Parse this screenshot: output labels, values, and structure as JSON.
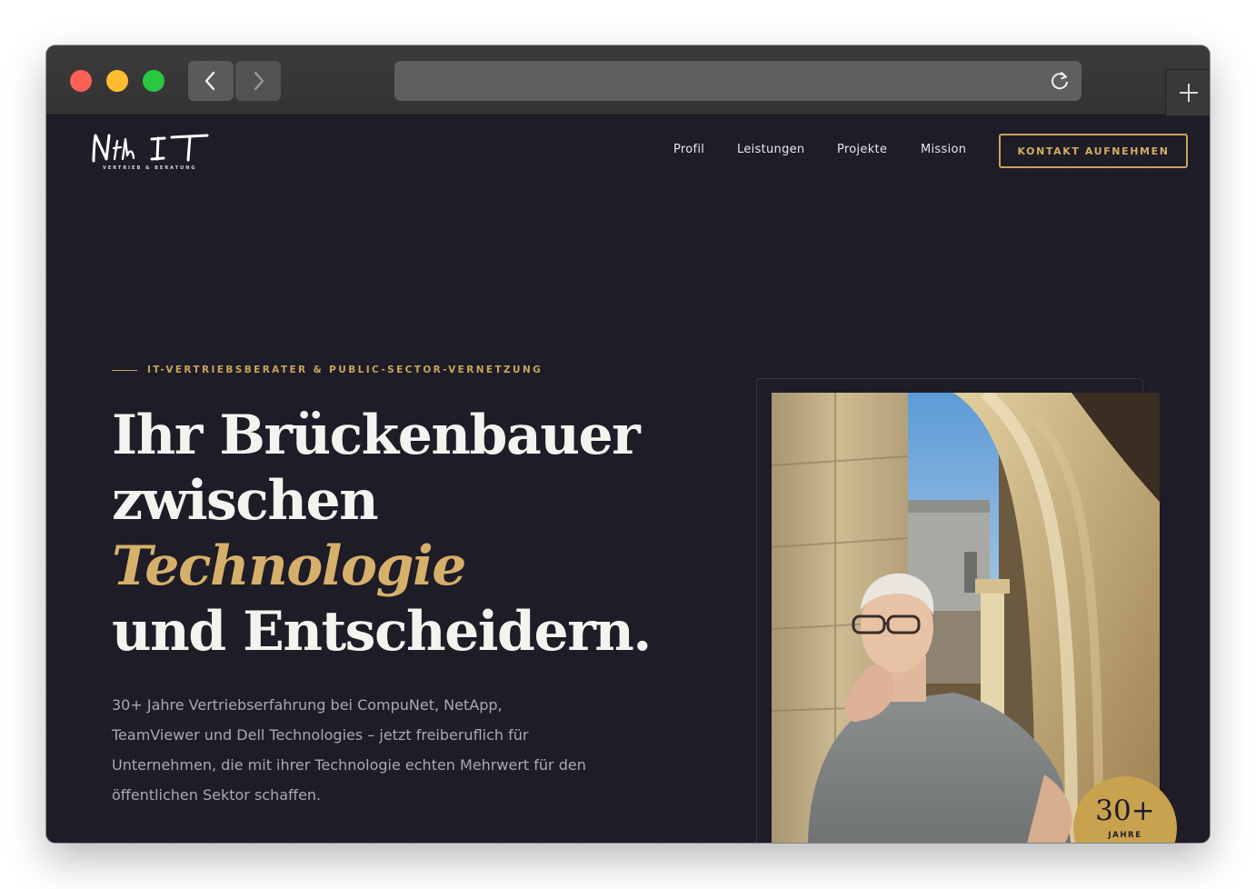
{
  "browser": {
    "traffic_lights": [
      "close",
      "minimize",
      "maximize"
    ],
    "back_icon": "chevron-left-icon",
    "forward_icon": "chevron-right-icon",
    "reload_icon": "reload-icon",
    "new_tab_icon": "plus-icon"
  },
  "site": {
    "logo_text": "Nfk IT",
    "logo_subtitle": "VERTRIEB & BERATUNG",
    "nav": {
      "items": [
        {
          "label": "Profil"
        },
        {
          "label": "Leistungen"
        },
        {
          "label": "Projekte"
        },
        {
          "label": "Mission"
        }
      ],
      "cta_label": "KONTAKT AUFNEHMEN"
    },
    "hero": {
      "eyebrow": "IT-VERTRIEBSBERATER & PUBLIC-SECTOR-VERNETZUNG",
      "headline_line1": "Ihr Brückenbauer",
      "headline_line2": "zwischen",
      "headline_accent": "Technologie",
      "headline_line4": "und Entscheidern.",
      "lead": "30+ Jahre Vertriebserfahrung bei CompuNet, NetApp, TeamViewer und Dell Technologies – jetzt freiberuflich für Unternehmen, die mit ihrer Technologie echten Mehrwert für den öffentlichen Sektor schaffen.",
      "badge_number": "30+",
      "badge_label": "JAHRE"
    }
  },
  "colors": {
    "background": "#1d1c27",
    "accent_gold": "#c9a45c",
    "text_light": "#f5f3ef",
    "text_muted": "#a9a9b4"
  }
}
